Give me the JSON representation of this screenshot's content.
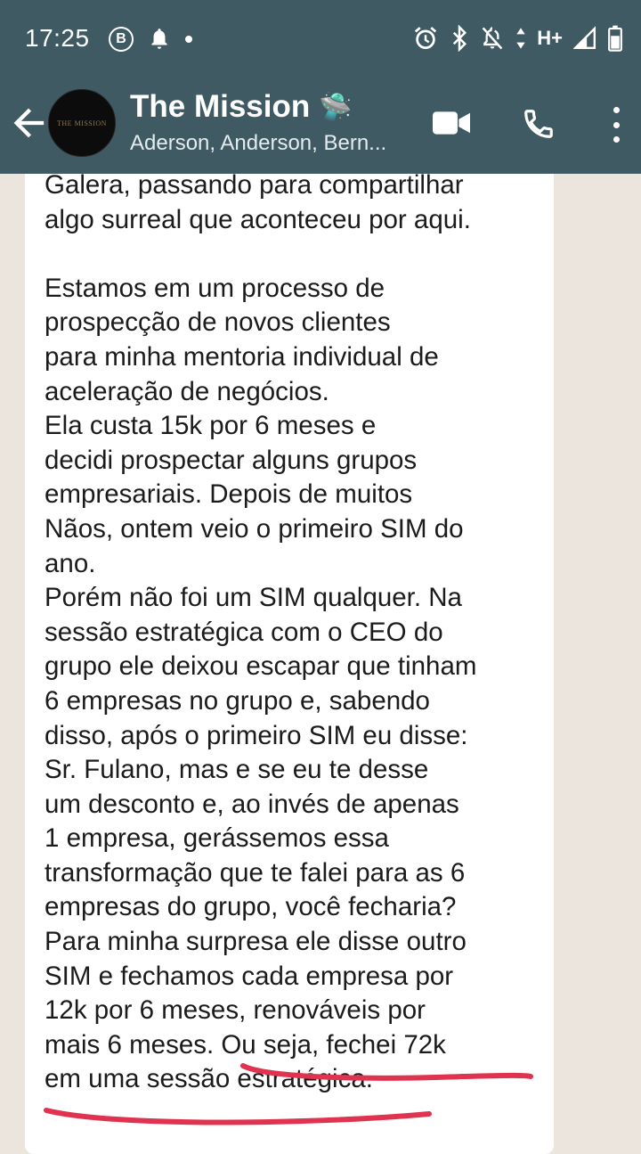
{
  "status_bar": {
    "time": "17:25",
    "b_badge": "B",
    "network": "H+"
  },
  "chat_header": {
    "title": "The Mission",
    "title_emoji": "🛸",
    "members": "Aderson, Anderson, Bern...",
    "avatar_text": "THE MISSION"
  },
  "message": {
    "text": "Galera, passando para compartilhar\nalgo surreal que aconteceu por aqui.\n\nEstamos em um processo de\nprospecção de novos clientes\npara minha mentoria individual de\naceleração de negócios.\nEla custa 15k por 6 meses e\ndecidi prospectar alguns grupos\nempresariais. Depois de muitos\nNãos, ontem veio o primeiro SIM do\nano.\nPorém não foi um SIM qualquer. Na\nsessão estratégica com o CEO do\ngrupo ele deixou escapar que tinham\n6 empresas no grupo e, sabendo\ndisso, após o primeiro SIM eu disse:\nSr. Fulano, mas e se eu te desse\num desconto e, ao invés de apenas\n1 empresa, gerássemos essa\ntransformação que te falei para as 6\nempresas do grupo, você fecharia?\nPara minha surpresa ele disse outro\nSIM e fechamos cada empresa por\n12k por 6 meses, renováveis por\nmais 6 meses. Ou seja, fechei 72k\nem uma sessão estratégica."
  },
  "icons": {
    "alarm": "alarm-icon",
    "bluetooth": "bluetooth-icon",
    "mute": "notifications-off-icon",
    "signal": "signal-icon",
    "battery": "battery-icon",
    "back": "arrow-back-icon",
    "video": "videocam-icon",
    "call": "phone-icon",
    "menu": "more-vert-icon"
  },
  "colors": {
    "header": "#3f5a63",
    "chat_background": "#ece5dd",
    "bubble": "#ffffff",
    "underline_markup": "#e0334f"
  }
}
